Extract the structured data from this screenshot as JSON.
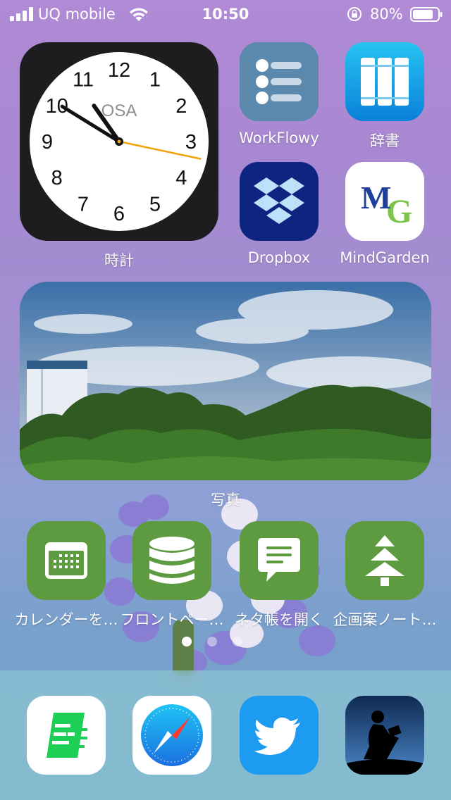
{
  "status_bar": {
    "carrier": "UQ mobile",
    "time": "10:50",
    "battery_percent": "80%",
    "signal_icon": "cellular-signal-icon",
    "wifi_icon": "wifi-icon",
    "rotation_lock_icon": "rotation-lock-icon",
    "battery_icon": "battery-icon"
  },
  "clock_widget": {
    "label": "時計",
    "city": "OSA",
    "numerals": [
      "12",
      "1",
      "2",
      "3",
      "4",
      "5",
      "6",
      "7",
      "8",
      "9",
      "10",
      "11"
    ],
    "time": "10:50:17"
  },
  "apps_top": [
    {
      "label": "WorkFlowy",
      "icon": "workflowy-icon"
    },
    {
      "label": "辞書",
      "icon": "dictionary-icon"
    },
    {
      "label": "Dropbox",
      "icon": "dropbox-icon"
    },
    {
      "label": "MindGarden",
      "icon": "mindgarden-icon"
    }
  ],
  "mindgarden_logo_text": "MG",
  "photos_widget": {
    "label": "写真"
  },
  "shortcuts": [
    {
      "label": "カレンダーを…",
      "icon": "calendar-icon"
    },
    {
      "label": "フロントペー…",
      "icon": "database-icon"
    },
    {
      "label": "ネタ帳を開く",
      "icon": "message-icon"
    },
    {
      "label": "企画案ノート…",
      "icon": "tree-icon"
    }
  ],
  "shortcut_color": "#5e9a3f",
  "page_indicator": {
    "pages": 3,
    "current": 1
  },
  "dock": [
    {
      "icon": "notes-app-icon"
    },
    {
      "icon": "safari-icon"
    },
    {
      "icon": "twitter-icon"
    },
    {
      "icon": "kindle-icon"
    }
  ]
}
